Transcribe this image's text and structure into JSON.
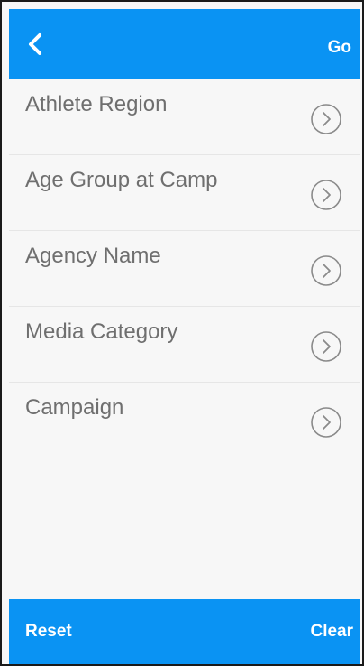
{
  "header": {
    "back_icon": "chevron-left-icon",
    "go_label": "Go"
  },
  "list": {
    "items": [
      {
        "label": "Athlete Region",
        "icon": "chevron-right-circle-icon"
      },
      {
        "label": "Age Group at Camp",
        "icon": "chevron-right-circle-icon"
      },
      {
        "label": "Agency Name",
        "icon": "chevron-right-circle-icon"
      },
      {
        "label": "Media Category",
        "icon": "chevron-right-circle-icon"
      },
      {
        "label": "Campaign",
        "icon": "chevron-right-circle-icon"
      }
    ]
  },
  "footer": {
    "reset_label": "Reset",
    "clear_label": "Clear"
  },
  "colors": {
    "accent": "#0a93f3",
    "label_text": "#6f6f6f",
    "background": "#f7f7f7"
  }
}
